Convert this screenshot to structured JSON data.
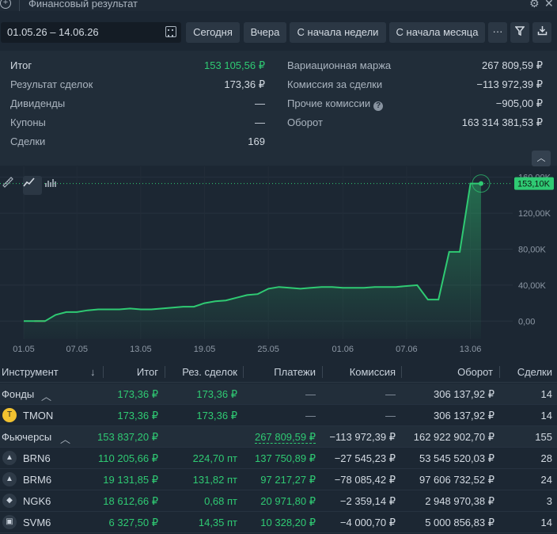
{
  "window": {
    "title": "Финансовый результат",
    "plus_icon": "plus-icon",
    "settings_icon": "gear-icon",
    "close_icon": "close-icon"
  },
  "toolbar": {
    "date_range": "01.05.26 – 14.06.26",
    "buttons": [
      "Сегодня",
      "Вчера",
      "С начала недели",
      "С начала месяца"
    ],
    "more_label": "···"
  },
  "summary": {
    "left": [
      {
        "label": "Итог",
        "value": "153 105,56 ₽"
      },
      {
        "label": "Результат сделок",
        "value": "173,36 ₽"
      },
      {
        "label": "Дивиденды",
        "value": "—"
      },
      {
        "label": "Купоны",
        "value": "—"
      },
      {
        "label": "Сделки",
        "value": "169"
      }
    ],
    "right": [
      {
        "label": "Вариационная маржа",
        "value": "267 809,59 ₽"
      },
      {
        "label": "Комиссия за сделки",
        "value": "−113 972,39 ₽"
      },
      {
        "label": "Прочие комиссии",
        "value": "−905,00 ₽"
      },
      {
        "label": "Оборот",
        "value": "163 314 381,53 ₽"
      }
    ]
  },
  "chart_data": {
    "type": "area",
    "x": [
      "01.05",
      "03.05",
      "04.05",
      "05.05",
      "06.05",
      "07.05",
      "08.05",
      "09.05",
      "10.05",
      "11.05",
      "12.05",
      "13.05",
      "14.05",
      "15.05",
      "16.05",
      "17.05",
      "18.05",
      "19.05",
      "20.05",
      "21.05",
      "22.05",
      "23.05",
      "24.05",
      "25.05",
      "26.05",
      "27.05",
      "28.05",
      "29.05",
      "30.05",
      "31.05",
      "01.06",
      "02.06",
      "03.06",
      "04.06",
      "05.06",
      "06.06",
      "07.06",
      "08.06",
      "09.06",
      "10.06",
      "11.06",
      "12.06",
      "13.06",
      "14.06"
    ],
    "values": [
      0,
      0,
      0,
      7,
      10,
      10,
      12,
      13,
      13,
      13,
      14,
      13,
      13,
      14,
      15,
      16,
      16,
      20,
      22,
      23,
      26,
      29,
      30,
      36,
      38,
      37,
      36,
      37,
      38,
      38,
      37,
      37,
      37,
      38,
      38,
      38,
      39,
      40,
      24,
      24,
      77,
      77,
      153,
      153
    ],
    "xticks": [
      "01.05",
      "07.05",
      "13.05",
      "19.05",
      "25.05",
      "01.06",
      "07.06",
      "13.06"
    ],
    "yticks": [
      "0,00",
      "40,00K",
      "80,00K",
      "120,00K",
      "160,00K"
    ],
    "ylim": [
      -20,
      165
    ],
    "last_label": "153,10K",
    "grid": true,
    "line_color": "#2fca73"
  },
  "chart_tools": [
    "ruler-icon",
    "line-chart-icon",
    "bar-chart-icon"
  ],
  "table": {
    "headers": [
      "Инструмент",
      "Итог",
      "Рез. сделок",
      "Платежи",
      "Комиссия",
      "Оборот",
      "Сделки"
    ],
    "sort_icon": "↓",
    "rows": [
      {
        "kind": "group",
        "name": "Фонды",
        "itog": "173,36 ₽",
        "rez": "173,36 ₽",
        "pay": "—",
        "com": "—",
        "turn": "306 137,92 ₽",
        "deals": "14"
      },
      {
        "kind": "item",
        "icon": "tmon-icon",
        "name": "TMON",
        "itog": "173,36 ₽",
        "rez": "173,36 ₽",
        "pay": "—",
        "com": "—",
        "turn": "306 137,92 ₽",
        "deals": "14"
      },
      {
        "kind": "group",
        "name": "Фьючерсы",
        "itog": "153 837,20 ₽",
        "rez": "",
        "pay": "267 809,59 ₽",
        "com": "−113 972,39 ₽",
        "turn": "162 922 902,70 ₽",
        "deals": "155"
      },
      {
        "kind": "item",
        "icon": "oil-icon",
        "name": "BRN6",
        "itog": "110 205,66 ₽",
        "rez": "224,70 пт",
        "pay": "137 750,89 ₽",
        "com": "−27 545,23 ₽",
        "turn": "53 545 520,03 ₽",
        "deals": "28"
      },
      {
        "kind": "item",
        "icon": "oil-icon",
        "name": "BRM6",
        "itog": "19 131,85 ₽",
        "rez": "131,82 пт",
        "pay": "97 217,27 ₽",
        "com": "−78 085,42 ₽",
        "turn": "97 606 732,52 ₽",
        "deals": "24"
      },
      {
        "kind": "item",
        "icon": "gas-icon",
        "name": "NGK6",
        "itog": "18 612,66 ₽",
        "rez": "0,68 пт",
        "pay": "20 971,80 ₽",
        "com": "−2 359,14 ₽",
        "turn": "2 948 970,38 ₽",
        "deals": "3"
      },
      {
        "kind": "item",
        "icon": "silver-icon",
        "name": "SVM6",
        "itog": "6 327,50 ₽",
        "rez": "14,35 пт",
        "pay": "10 328,20 ₽",
        "com": "−4 000,70 ₽",
        "turn": "5 000 856,83 ₽",
        "deals": "14"
      }
    ]
  }
}
